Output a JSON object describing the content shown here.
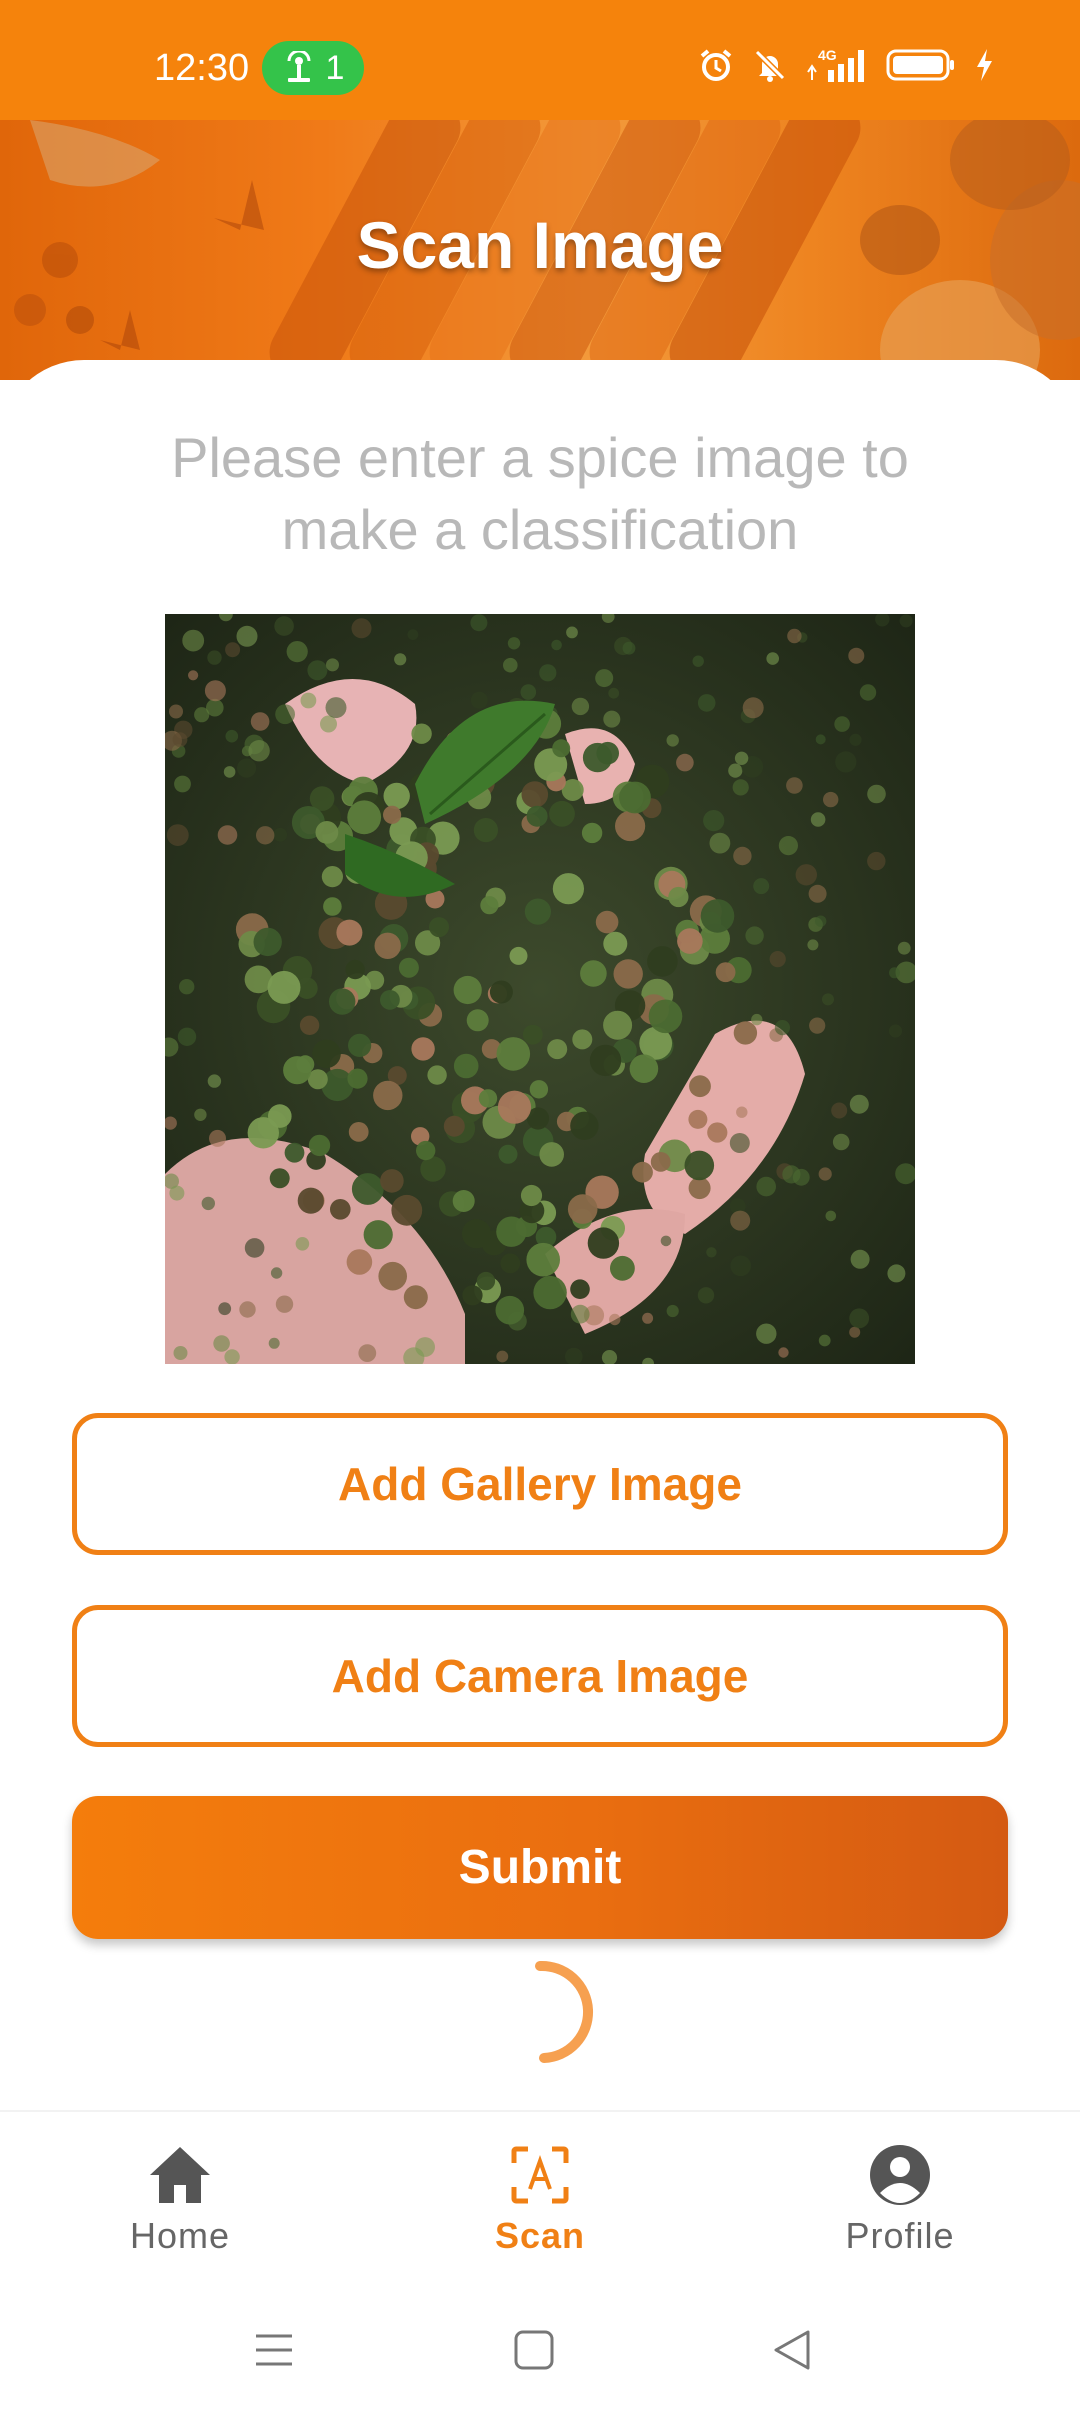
{
  "status_bar": {
    "time": "12:30",
    "hotspot_count": "1",
    "icons": [
      "alarm-icon",
      "bell-muted-icon",
      "signal-4g-icon",
      "battery-icon",
      "charging-icon"
    ],
    "network_label": "4G",
    "background_color": "#f5830c"
  },
  "header": {
    "title": "Scan Image"
  },
  "content": {
    "instruction": "Please enter a spice image to make a classification",
    "preview_image": "photo of green peppercorns in hands",
    "gallery_button_label": "Add Gallery Image",
    "camera_button_label": "Add Camera Image",
    "submit_button_label": "Submit",
    "loading": true
  },
  "bottom_nav": {
    "items": [
      {
        "label": "Home",
        "icon": "home-icon",
        "active": false
      },
      {
        "label": "Scan",
        "icon": "scan-text-icon",
        "active": true
      },
      {
        "label": "Profile",
        "icon": "account-circle-icon",
        "active": false
      }
    ]
  },
  "system_nav": {
    "buttons": [
      "menu-icon",
      "home-square-icon",
      "back-triangle-icon"
    ]
  },
  "colors": {
    "accent": "#f08015",
    "muted_text": "#b8b8b8",
    "nav_inactive": "#666666"
  }
}
